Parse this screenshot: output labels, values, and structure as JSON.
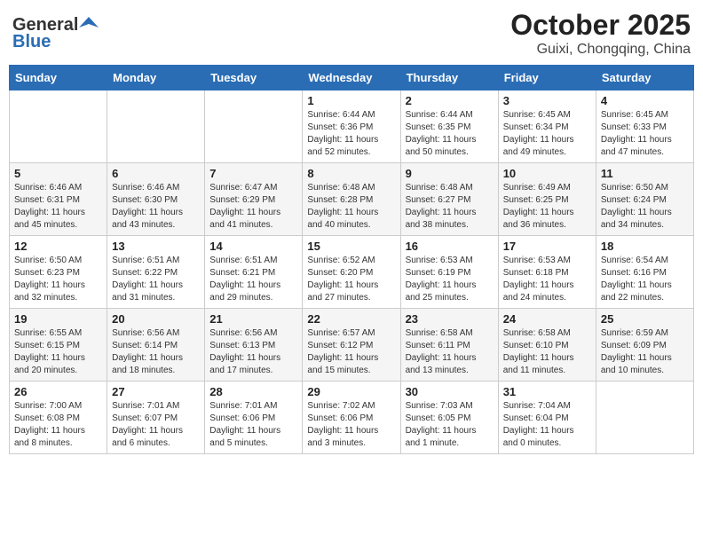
{
  "header": {
    "logo_general": "General",
    "logo_blue": "Blue",
    "title": "October 2025",
    "subtitle": "Guixi, Chongqing, China"
  },
  "weekdays": [
    "Sunday",
    "Monday",
    "Tuesday",
    "Wednesday",
    "Thursday",
    "Friday",
    "Saturday"
  ],
  "weeks": [
    [
      {
        "day": "",
        "sunrise": "",
        "sunset": "",
        "daylight": ""
      },
      {
        "day": "",
        "sunrise": "",
        "sunset": "",
        "daylight": ""
      },
      {
        "day": "",
        "sunrise": "",
        "sunset": "",
        "daylight": ""
      },
      {
        "day": "1",
        "sunrise": "Sunrise: 6:44 AM",
        "sunset": "Sunset: 6:36 PM",
        "daylight": "Daylight: 11 hours and 52 minutes."
      },
      {
        "day": "2",
        "sunrise": "Sunrise: 6:44 AM",
        "sunset": "Sunset: 6:35 PM",
        "daylight": "Daylight: 11 hours and 50 minutes."
      },
      {
        "day": "3",
        "sunrise": "Sunrise: 6:45 AM",
        "sunset": "Sunset: 6:34 PM",
        "daylight": "Daylight: 11 hours and 49 minutes."
      },
      {
        "day": "4",
        "sunrise": "Sunrise: 6:45 AM",
        "sunset": "Sunset: 6:33 PM",
        "daylight": "Daylight: 11 hours and 47 minutes."
      }
    ],
    [
      {
        "day": "5",
        "sunrise": "Sunrise: 6:46 AM",
        "sunset": "Sunset: 6:31 PM",
        "daylight": "Daylight: 11 hours and 45 minutes."
      },
      {
        "day": "6",
        "sunrise": "Sunrise: 6:46 AM",
        "sunset": "Sunset: 6:30 PM",
        "daylight": "Daylight: 11 hours and 43 minutes."
      },
      {
        "day": "7",
        "sunrise": "Sunrise: 6:47 AM",
        "sunset": "Sunset: 6:29 PM",
        "daylight": "Daylight: 11 hours and 41 minutes."
      },
      {
        "day": "8",
        "sunrise": "Sunrise: 6:48 AM",
        "sunset": "Sunset: 6:28 PM",
        "daylight": "Daylight: 11 hours and 40 minutes."
      },
      {
        "day": "9",
        "sunrise": "Sunrise: 6:48 AM",
        "sunset": "Sunset: 6:27 PM",
        "daylight": "Daylight: 11 hours and 38 minutes."
      },
      {
        "day": "10",
        "sunrise": "Sunrise: 6:49 AM",
        "sunset": "Sunset: 6:25 PM",
        "daylight": "Daylight: 11 hours and 36 minutes."
      },
      {
        "day": "11",
        "sunrise": "Sunrise: 6:50 AM",
        "sunset": "Sunset: 6:24 PM",
        "daylight": "Daylight: 11 hours and 34 minutes."
      }
    ],
    [
      {
        "day": "12",
        "sunrise": "Sunrise: 6:50 AM",
        "sunset": "Sunset: 6:23 PM",
        "daylight": "Daylight: 11 hours and 32 minutes."
      },
      {
        "day": "13",
        "sunrise": "Sunrise: 6:51 AM",
        "sunset": "Sunset: 6:22 PM",
        "daylight": "Daylight: 11 hours and 31 minutes."
      },
      {
        "day": "14",
        "sunrise": "Sunrise: 6:51 AM",
        "sunset": "Sunset: 6:21 PM",
        "daylight": "Daylight: 11 hours and 29 minutes."
      },
      {
        "day": "15",
        "sunrise": "Sunrise: 6:52 AM",
        "sunset": "Sunset: 6:20 PM",
        "daylight": "Daylight: 11 hours and 27 minutes."
      },
      {
        "day": "16",
        "sunrise": "Sunrise: 6:53 AM",
        "sunset": "Sunset: 6:19 PM",
        "daylight": "Daylight: 11 hours and 25 minutes."
      },
      {
        "day": "17",
        "sunrise": "Sunrise: 6:53 AM",
        "sunset": "Sunset: 6:18 PM",
        "daylight": "Daylight: 11 hours and 24 minutes."
      },
      {
        "day": "18",
        "sunrise": "Sunrise: 6:54 AM",
        "sunset": "Sunset: 6:16 PM",
        "daylight": "Daylight: 11 hours and 22 minutes."
      }
    ],
    [
      {
        "day": "19",
        "sunrise": "Sunrise: 6:55 AM",
        "sunset": "Sunset: 6:15 PM",
        "daylight": "Daylight: 11 hours and 20 minutes."
      },
      {
        "day": "20",
        "sunrise": "Sunrise: 6:56 AM",
        "sunset": "Sunset: 6:14 PM",
        "daylight": "Daylight: 11 hours and 18 minutes."
      },
      {
        "day": "21",
        "sunrise": "Sunrise: 6:56 AM",
        "sunset": "Sunset: 6:13 PM",
        "daylight": "Daylight: 11 hours and 17 minutes."
      },
      {
        "day": "22",
        "sunrise": "Sunrise: 6:57 AM",
        "sunset": "Sunset: 6:12 PM",
        "daylight": "Daylight: 11 hours and 15 minutes."
      },
      {
        "day": "23",
        "sunrise": "Sunrise: 6:58 AM",
        "sunset": "Sunset: 6:11 PM",
        "daylight": "Daylight: 11 hours and 13 minutes."
      },
      {
        "day": "24",
        "sunrise": "Sunrise: 6:58 AM",
        "sunset": "Sunset: 6:10 PM",
        "daylight": "Daylight: 11 hours and 11 minutes."
      },
      {
        "day": "25",
        "sunrise": "Sunrise: 6:59 AM",
        "sunset": "Sunset: 6:09 PM",
        "daylight": "Daylight: 11 hours and 10 minutes."
      }
    ],
    [
      {
        "day": "26",
        "sunrise": "Sunrise: 7:00 AM",
        "sunset": "Sunset: 6:08 PM",
        "daylight": "Daylight: 11 hours and 8 minutes."
      },
      {
        "day": "27",
        "sunrise": "Sunrise: 7:01 AM",
        "sunset": "Sunset: 6:07 PM",
        "daylight": "Daylight: 11 hours and 6 minutes."
      },
      {
        "day": "28",
        "sunrise": "Sunrise: 7:01 AM",
        "sunset": "Sunset: 6:06 PM",
        "daylight": "Daylight: 11 hours and 5 minutes."
      },
      {
        "day": "29",
        "sunrise": "Sunrise: 7:02 AM",
        "sunset": "Sunset: 6:06 PM",
        "daylight": "Daylight: 11 hours and 3 minutes."
      },
      {
        "day": "30",
        "sunrise": "Sunrise: 7:03 AM",
        "sunset": "Sunset: 6:05 PM",
        "daylight": "Daylight: 11 hours and 1 minute."
      },
      {
        "day": "31",
        "sunrise": "Sunrise: 7:04 AM",
        "sunset": "Sunset: 6:04 PM",
        "daylight": "Daylight: 11 hours and 0 minutes."
      },
      {
        "day": "",
        "sunrise": "",
        "sunset": "",
        "daylight": ""
      }
    ]
  ]
}
